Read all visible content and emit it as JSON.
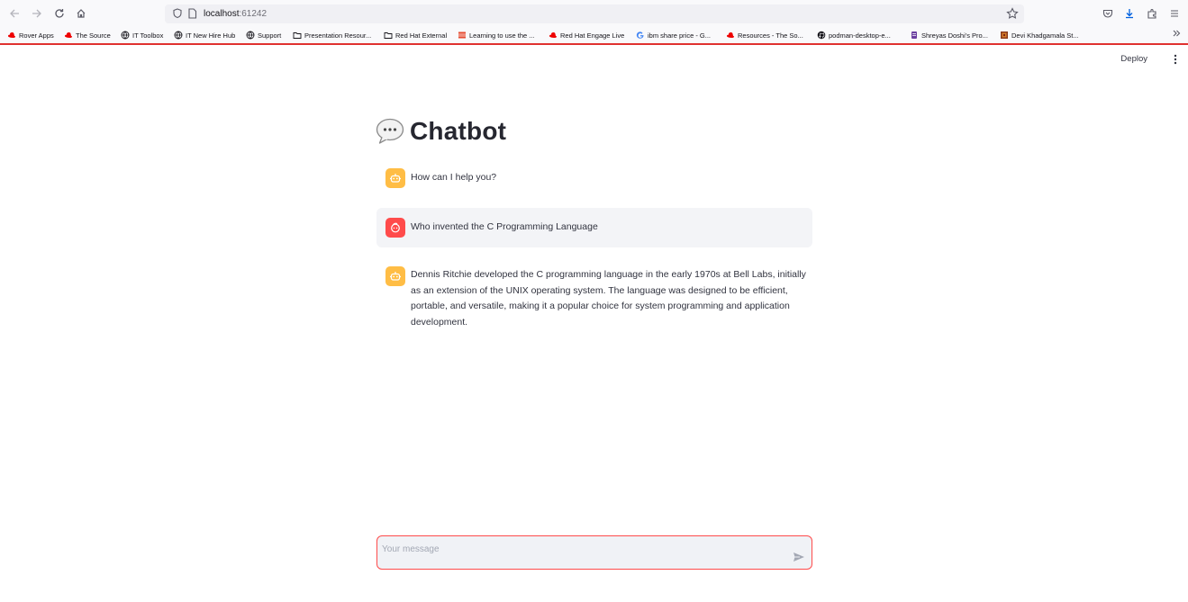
{
  "browser": {
    "url_host": "localhost",
    "url_port": ":61242",
    "icons": {
      "back": "back-arrow-icon",
      "forward": "forward-arrow-icon",
      "reload": "reload-icon",
      "home": "home-icon",
      "bookmark_star": "star-icon",
      "pocket": "pocket-icon",
      "downloads": "download-icon",
      "extensions": "extensions-icon",
      "menu": "hamburger-menu-icon",
      "overflow": "chevron-double-right-icon"
    }
  },
  "bookmarks": [
    {
      "label": "Rover Apps",
      "icon": "redhat-icon"
    },
    {
      "label": "The Source",
      "icon": "redhat-icon"
    },
    {
      "label": "IT Toolbox",
      "icon": "globe-icon"
    },
    {
      "label": "IT New Hire Hub",
      "icon": "globe-icon"
    },
    {
      "label": "Support",
      "icon": "globe-icon"
    },
    {
      "label": "Presentation Resour...",
      "icon": "folder-icon"
    },
    {
      "label": "Red Hat External",
      "icon": "folder-icon"
    },
    {
      "label": "Learning to use the ...",
      "icon": "book-icon"
    },
    {
      "label": "Red Hat Engage Live",
      "icon": "redhat-icon"
    },
    {
      "label": "ibm share price - G...",
      "icon": "google-icon"
    },
    {
      "label": "Resources - The So...",
      "icon": "redhat-icon"
    },
    {
      "label": "podman-desktop-e...",
      "icon": "github-icon"
    },
    {
      "label": "Shreyas Doshi's Pro...",
      "icon": "app-icon"
    },
    {
      "label": "Devi Khadgamala St...",
      "icon": "image-icon"
    }
  ],
  "app": {
    "deploy_label": "Deploy",
    "title": "Chatbot",
    "title_icon": "speech-bubble-icon",
    "accent_color": "#ff4b4b",
    "assistant_avatar_color": "#ffbd45",
    "messages": [
      {
        "role": "assistant",
        "text": "How can I help you?"
      },
      {
        "role": "user",
        "text": "Who invented the C Programming Language"
      },
      {
        "role": "assistant",
        "text": "Dennis Ritchie developed the C programming language in the early 1970s at Bell Labs, initially as an extension of the UNIX operating system. The language was designed to be efficient, portable, and versatile, making it a popular choice for system programming and application development."
      }
    ],
    "input_placeholder": "Your message"
  }
}
